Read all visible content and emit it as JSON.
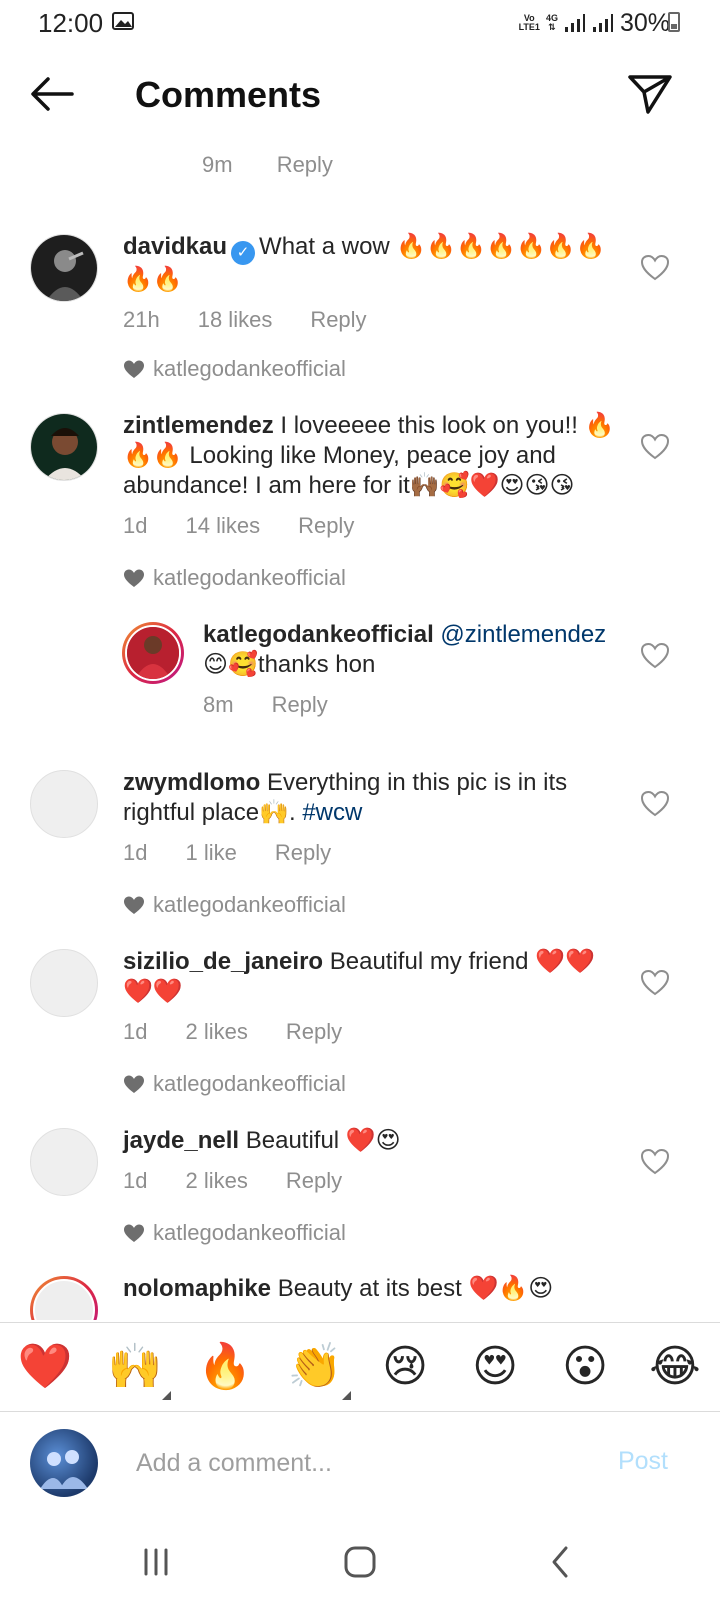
{
  "status_bar": {
    "time": "12:00",
    "network_top": "Vo",
    "network_bottom": "LTE1",
    "data": "4G",
    "battery": "30%"
  },
  "header": {
    "title": "Comments"
  },
  "partial_meta": {
    "time": "9m",
    "reply": "Reply"
  },
  "comments": [
    {
      "username": "davidkau",
      "verified": true,
      "text": "What a wow 🔥🔥🔥🔥🔥🔥🔥🔥🔥",
      "time": "21h",
      "likes": "18 likes",
      "reply": "Reply",
      "liked_by": "katlegodankeofficial"
    },
    {
      "username": "zintlemendez",
      "text": "I loveeeee this look on you!! 🔥🔥🔥 Looking like Money, peace joy and abundance! I am here for it🙌🏾🥰❤️😍😘😘",
      "time": "1d",
      "likes": "14 likes",
      "reply": "Reply",
      "liked_by": "katlegodankeofficial"
    },
    {
      "username": "katlegodankeofficial",
      "mention": "@zintlemendez",
      "text": "😊🥰thanks hon",
      "time": "8m",
      "reply": "Reply"
    },
    {
      "username": "zwymdlomo",
      "text": "Everything in this pic is in its rightful place🙌.",
      "hashtag": "#wcw",
      "time": "1d",
      "likes": "1 like",
      "reply": "Reply",
      "liked_by": "katlegodankeofficial"
    },
    {
      "username": "sizilio_de_janeiro",
      "text": "Beautiful my friend ❤️❤️❤️❤️",
      "time": "1d",
      "likes": "2 likes",
      "reply": "Reply",
      "liked_by": "katlegodankeofficial"
    },
    {
      "username": "jayde_nell",
      "text": "Beautiful ❤️😍",
      "time": "1d",
      "likes": "2 likes",
      "reply": "Reply",
      "liked_by": "katlegodankeofficial"
    },
    {
      "username": "nolomaphike",
      "text": "Beauty at its best ❤️🔥😍"
    }
  ],
  "emoji_bar": [
    "❤️",
    "🙌",
    "🔥",
    "👏",
    "😢",
    "😍",
    "😮",
    "😂"
  ],
  "composer": {
    "placeholder": "Add a comment...",
    "post_label": "Post"
  },
  "colors": {
    "link": "#00376b",
    "meta": "#8e8e8e",
    "post_disabled": "#b2dffc",
    "verified": "#3897f0"
  }
}
